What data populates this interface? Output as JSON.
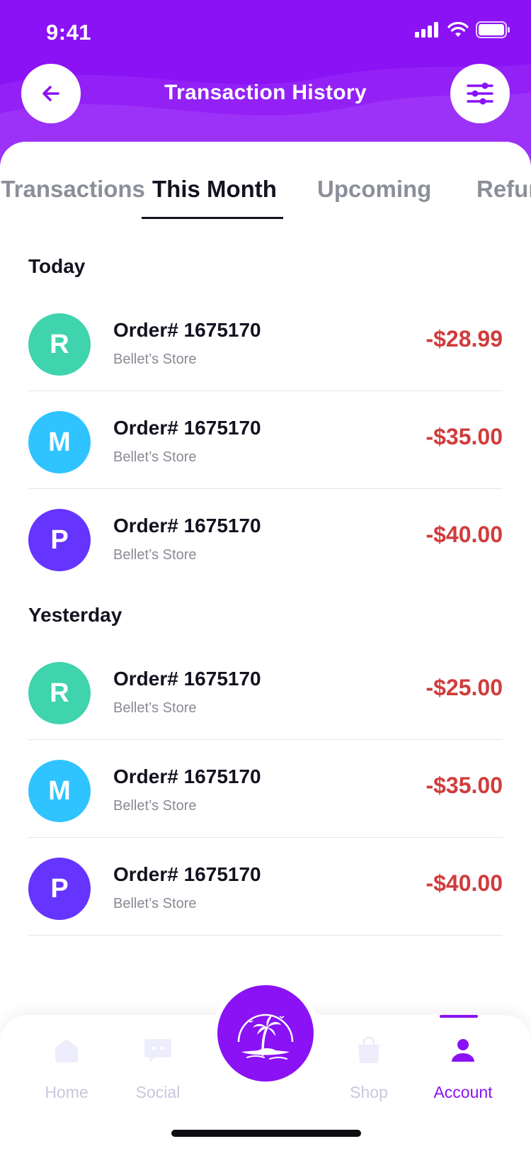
{
  "status_bar": {
    "time": "9:41"
  },
  "header": {
    "title": "Transaction History",
    "back_icon": "arrow-left-icon",
    "filter_icon": "sliders-icon",
    "background": "#8a12f5"
  },
  "tabs": [
    {
      "label": "All Transactions",
      "active": false
    },
    {
      "label": "This Month",
      "active": true
    },
    {
      "label": "Upcoming",
      "active": false
    },
    {
      "label": "Refunds",
      "active": false
    }
  ],
  "sections": [
    {
      "title": "Today",
      "transactions": [
        {
          "initial": "R",
          "avatar_color": "#3fd3ae",
          "order": "Order# 1675170",
          "store": "Bellet’s Store",
          "amount": "-$28.99"
        },
        {
          "initial": "M",
          "avatar_color": "#2fc3ff",
          "order": "Order# 1675170",
          "store": "Bellet’s Store",
          "amount": "-$35.00"
        },
        {
          "initial": "P",
          "avatar_color": "#6534ff",
          "order": "Order# 1675170",
          "store": "Bellet’s Store",
          "amount": "-$40.00"
        }
      ]
    },
    {
      "title": "Yesterday",
      "transactions": [
        {
          "initial": "R",
          "avatar_color": "#3fd3ae",
          "order": "Order# 1675170",
          "store": "Bellet’s Store",
          "amount": "-$25.00"
        },
        {
          "initial": "M",
          "avatar_color": "#2fc3ff",
          "order": "Order# 1675170",
          "store": "Bellet’s Store",
          "amount": "-$35.00"
        },
        {
          "initial": "P",
          "avatar_color": "#6534ff",
          "order": "Order# 1675170",
          "store": "Bellet’s Store",
          "amount": "-$40.00"
        }
      ]
    }
  ],
  "bottom_nav": {
    "items": [
      {
        "label": "Home",
        "icon": "home-icon",
        "active": false
      },
      {
        "label": "Social",
        "icon": "chat-icon",
        "active": false
      },
      {
        "label": "Shop",
        "icon": "shopping-bag-icon",
        "active": false
      },
      {
        "label": "Account",
        "icon": "user-icon",
        "active": true
      }
    ],
    "center_icon": "palm-tree-island-icon"
  },
  "colors": {
    "accent": "#8a12f5",
    "negative_amount": "#d13c3c",
    "nav_inactive": "#c9c6de"
  }
}
